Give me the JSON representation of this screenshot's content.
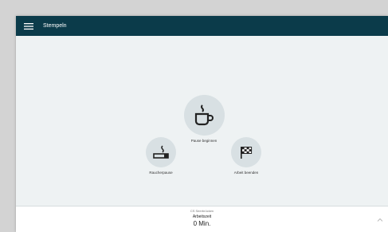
{
  "header": {
    "title": "Stempeln",
    "menu_icon": "hamburger-menu-icon",
    "background_color": "#0b3b4a"
  },
  "actions": [
    {
      "label": "Pause beginnen",
      "icon": "coffee-cup-icon"
    },
    {
      "label": "Raucherpause",
      "icon": "cigarette-icon"
    },
    {
      "label": "Arbeit beenden",
      "icon": "checkered-flag-icon"
    }
  ],
  "footer": {
    "location": "CS Seerbrücken",
    "worktime_label": "Arbeitszeit",
    "worktime_value": "0 Min.",
    "expand_icon": "chevron-up-icon"
  }
}
